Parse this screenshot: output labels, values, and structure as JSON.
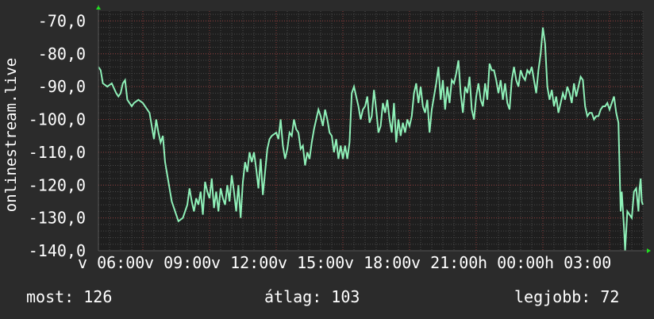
{
  "colors": {
    "background": "#2b2b2b",
    "plot_background": "#1e1e1e",
    "grid_major": "#8a3a3a",
    "grid_minor": "#4a4a4a",
    "line": "#8ff0b8",
    "axis_arrow": "#22dd22",
    "text": "#ffffff"
  },
  "stats": {
    "current": "most: 126",
    "average": "átlag: 103",
    "best": "legjobb: 72"
  },
  "chart_data": {
    "type": "line",
    "ylabel": "onlinestream.live",
    "ylim": [
      -140,
      -67
    ],
    "y_ticks": [
      -70,
      -80,
      -90,
      -100,
      -110,
      -120,
      -130,
      -140
    ],
    "y_tick_labels": [
      "-70,0",
      "-80,0",
      "-90,0",
      "-100,0",
      "-110,0",
      "-120,0",
      "-130,0",
      "-140,0"
    ],
    "x_range_hours": [
      4.0,
      28.5
    ],
    "x_ticks": [
      {
        "hour": 6,
        "label": "v 06:00"
      },
      {
        "hour": 9,
        "label": "v 09:00"
      },
      {
        "hour": 12,
        "label": "v 12:00"
      },
      {
        "hour": 15,
        "label": "v 15:00"
      },
      {
        "hour": 18,
        "label": "v 18:00"
      },
      {
        "hour": 21,
        "label": "v 21:00"
      },
      {
        "hour": 24,
        "label": "h 00:00"
      },
      {
        "hour": 27,
        "label": "h 03:00"
      }
    ],
    "series": [
      {
        "values": [
          [
            4.0,
            -84
          ],
          [
            4.1,
            -85
          ],
          [
            4.2,
            -89
          ],
          [
            4.4,
            -90
          ],
          [
            4.6,
            -89
          ],
          [
            4.8,
            -92
          ],
          [
            4.9,
            -93
          ],
          [
            5.0,
            -92
          ],
          [
            5.1,
            -89
          ],
          [
            5.2,
            -88
          ],
          [
            5.3,
            -94
          ],
          [
            5.5,
            -96
          ],
          [
            5.6,
            -95
          ],
          [
            5.8,
            -94
          ],
          [
            6.0,
            -95
          ],
          [
            6.1,
            -96
          ],
          [
            6.3,
            -98
          ],
          [
            6.5,
            -106
          ],
          [
            6.6,
            -100
          ],
          [
            6.7,
            -104
          ],
          [
            6.8,
            -107
          ],
          [
            6.9,
            -105
          ],
          [
            7.0,
            -113
          ],
          [
            7.2,
            -121
          ],
          [
            7.3,
            -125
          ],
          [
            7.5,
            -129
          ],
          [
            7.6,
            -131
          ],
          [
            7.8,
            -130
          ],
          [
            8.0,
            -126
          ],
          [
            8.1,
            -121
          ],
          [
            8.2,
            -125
          ],
          [
            8.3,
            -128
          ],
          [
            8.4,
            -124
          ],
          [
            8.5,
            -126
          ],
          [
            8.6,
            -122
          ],
          [
            8.7,
            -129
          ],
          [
            8.8,
            -119
          ],
          [
            8.9,
            -122
          ],
          [
            9.0,
            -124
          ],
          [
            9.1,
            -118
          ],
          [
            9.2,
            -127
          ],
          [
            9.3,
            -122
          ],
          [
            9.4,
            -128
          ],
          [
            9.5,
            -121
          ],
          [
            9.6,
            -124
          ],
          [
            9.7,
            -126
          ],
          [
            9.8,
            -120
          ],
          [
            9.9,
            -125
          ],
          [
            10.0,
            -117
          ],
          [
            10.1,
            -122
          ],
          [
            10.2,
            -128
          ],
          [
            10.3,
            -120
          ],
          [
            10.4,
            -130
          ],
          [
            10.5,
            -119
          ],
          [
            10.6,
            -113
          ],
          [
            10.7,
            -116
          ],
          [
            10.8,
            -110
          ],
          [
            10.9,
            -113
          ],
          [
            11.0,
            -110
          ],
          [
            11.1,
            -115
          ],
          [
            11.2,
            -121
          ],
          [
            11.3,
            -112
          ],
          [
            11.4,
            -123
          ],
          [
            11.5,
            -116
          ],
          [
            11.6,
            -109
          ],
          [
            11.7,
            -106
          ],
          [
            11.8,
            -105
          ],
          [
            12.0,
            -104
          ],
          [
            12.1,
            -106
          ],
          [
            12.2,
            -100
          ],
          [
            12.3,
            -108
          ],
          [
            12.4,
            -112
          ],
          [
            12.5,
            -109
          ],
          [
            12.6,
            -104
          ],
          [
            12.7,
            -105
          ],
          [
            12.8,
            -100
          ],
          [
            12.9,
            -103
          ],
          [
            13.0,
            -104
          ],
          [
            13.1,
            -109
          ],
          [
            13.2,
            -108
          ],
          [
            13.3,
            -114
          ],
          [
            13.4,
            -110
          ],
          [
            13.5,
            -112
          ],
          [
            13.6,
            -107
          ],
          [
            13.7,
            -103
          ],
          [
            13.8,
            -100
          ],
          [
            13.9,
            -97
          ],
          [
            14.0,
            -99
          ],
          [
            14.1,
            -102
          ],
          [
            14.2,
            -97
          ],
          [
            14.3,
            -100
          ],
          [
            14.4,
            -104
          ],
          [
            14.5,
            -105
          ],
          [
            14.6,
            -110
          ],
          [
            14.7,
            -106
          ],
          [
            14.8,
            -112
          ],
          [
            14.9,
            -108
          ],
          [
            15.0,
            -112
          ],
          [
            15.1,
            -108
          ],
          [
            15.2,
            -112
          ],
          [
            15.3,
            -107
          ],
          [
            15.4,
            -92
          ],
          [
            15.5,
            -90
          ],
          [
            15.6,
            -93
          ],
          [
            15.7,
            -96
          ],
          [
            15.8,
            -100
          ],
          [
            15.9,
            -97
          ],
          [
            16.0,
            -96
          ],
          [
            16.1,
            -93
          ],
          [
            16.2,
            -101
          ],
          [
            16.3,
            -99
          ],
          [
            16.4,
            -91
          ],
          [
            16.5,
            -97
          ],
          [
            16.6,
            -104
          ],
          [
            16.7,
            -102
          ],
          [
            16.8,
            -95
          ],
          [
            16.9,
            -98
          ],
          [
            17.0,
            -94
          ],
          [
            17.1,
            -100
          ],
          [
            17.2,
            -104
          ],
          [
            17.3,
            -95
          ],
          [
            17.4,
            -107
          ],
          [
            17.5,
            -100
          ],
          [
            17.6,
            -105
          ],
          [
            17.7,
            -101
          ],
          [
            17.8,
            -104
          ],
          [
            17.9,
            -100
          ],
          [
            18.0,
            -102
          ],
          [
            18.1,
            -99
          ],
          [
            18.2,
            -92
          ],
          [
            18.3,
            -89
          ],
          [
            18.4,
            -95
          ],
          [
            18.5,
            -90
          ],
          [
            18.6,
            -96
          ],
          [
            18.7,
            -98
          ],
          [
            18.8,
            -94
          ],
          [
            18.9,
            -104
          ],
          [
            19.0,
            -97
          ],
          [
            19.1,
            -93
          ],
          [
            19.2,
            -89
          ],
          [
            19.3,
            -84
          ],
          [
            19.4,
            -94
          ],
          [
            19.5,
            -88
          ],
          [
            19.6,
            -97
          ],
          [
            19.7,
            -90
          ],
          [
            19.8,
            -95
          ],
          [
            19.9,
            -88
          ],
          [
            20.0,
            -89
          ],
          [
            20.1,
            -86
          ],
          [
            20.2,
            -82
          ],
          [
            20.3,
            -92
          ],
          [
            20.4,
            -98
          ],
          [
            20.5,
            -90
          ],
          [
            20.6,
            -92
          ],
          [
            20.7,
            -87
          ],
          [
            20.8,
            -97
          ],
          [
            20.9,
            -100
          ],
          [
            21.0,
            -93
          ],
          [
            21.1,
            -89
          ],
          [
            21.2,
            -94
          ],
          [
            21.3,
            -96
          ],
          [
            21.4,
            -89
          ],
          [
            21.5,
            -94
          ],
          [
            21.6,
            -83
          ],
          [
            21.7,
            -85
          ],
          [
            21.8,
            -85
          ],
          [
            21.9,
            -88
          ],
          [
            22.0,
            -92
          ],
          [
            22.1,
            -88
          ],
          [
            22.2,
            -94
          ],
          [
            22.3,
            -89
          ],
          [
            22.4,
            -95
          ],
          [
            22.5,
            -97
          ],
          [
            22.6,
            -88
          ],
          [
            22.7,
            -84
          ],
          [
            22.8,
            -88
          ],
          [
            22.9,
            -90
          ],
          [
            23.0,
            -85
          ],
          [
            23.1,
            -87
          ],
          [
            23.2,
            -88
          ],
          [
            23.3,
            -85
          ],
          [
            23.4,
            -86
          ],
          [
            23.5,
            -84
          ],
          [
            23.6,
            -88
          ],
          [
            23.7,
            -92
          ],
          [
            23.8,
            -85
          ],
          [
            23.9,
            -80
          ],
          [
            24.0,
            -72
          ],
          [
            24.1,
            -77
          ],
          [
            24.2,
            -90
          ],
          [
            24.3,
            -94
          ],
          [
            24.4,
            -91
          ],
          [
            24.5,
            -96
          ],
          [
            24.6,
            -93
          ],
          [
            24.7,
            -98
          ],
          [
            24.8,
            -95
          ],
          [
            24.9,
            -92
          ],
          [
            25.0,
            -94
          ],
          [
            25.1,
            -90
          ],
          [
            25.2,
            -92
          ],
          [
            25.3,
            -95
          ],
          [
            25.4,
            -89
          ],
          [
            25.5,
            -93
          ],
          [
            25.6,
            -90
          ],
          [
            25.7,
            -87
          ],
          [
            25.8,
            -88
          ],
          [
            25.9,
            -96
          ],
          [
            26.0,
            -99
          ],
          [
            26.1,
            -98
          ],
          [
            26.2,
            -98
          ],
          [
            26.3,
            -100
          ],
          [
            26.4,
            -99
          ],
          [
            26.5,
            -99
          ],
          [
            26.6,
            -97
          ],
          [
            26.7,
            -96
          ],
          [
            26.8,
            -96
          ],
          [
            26.9,
            -95
          ],
          [
            27.0,
            -97
          ],
          [
            27.1,
            -95
          ],
          [
            27.2,
            -93
          ],
          [
            27.3,
            -98
          ],
          [
            27.4,
            -101
          ],
          [
            27.5,
            -128
          ],
          [
            27.55,
            -122
          ],
          [
            27.65,
            -133
          ],
          [
            27.7,
            -140
          ],
          [
            27.8,
            -128
          ],
          [
            27.9,
            -129
          ],
          [
            28.0,
            -130
          ],
          [
            28.1,
            -122
          ],
          [
            28.2,
            -121
          ],
          [
            28.3,
            -128
          ],
          [
            28.35,
            -121
          ],
          [
            28.4,
            -118
          ],
          [
            28.45,
            -125
          ],
          [
            28.5,
            -126
          ]
        ]
      }
    ]
  }
}
